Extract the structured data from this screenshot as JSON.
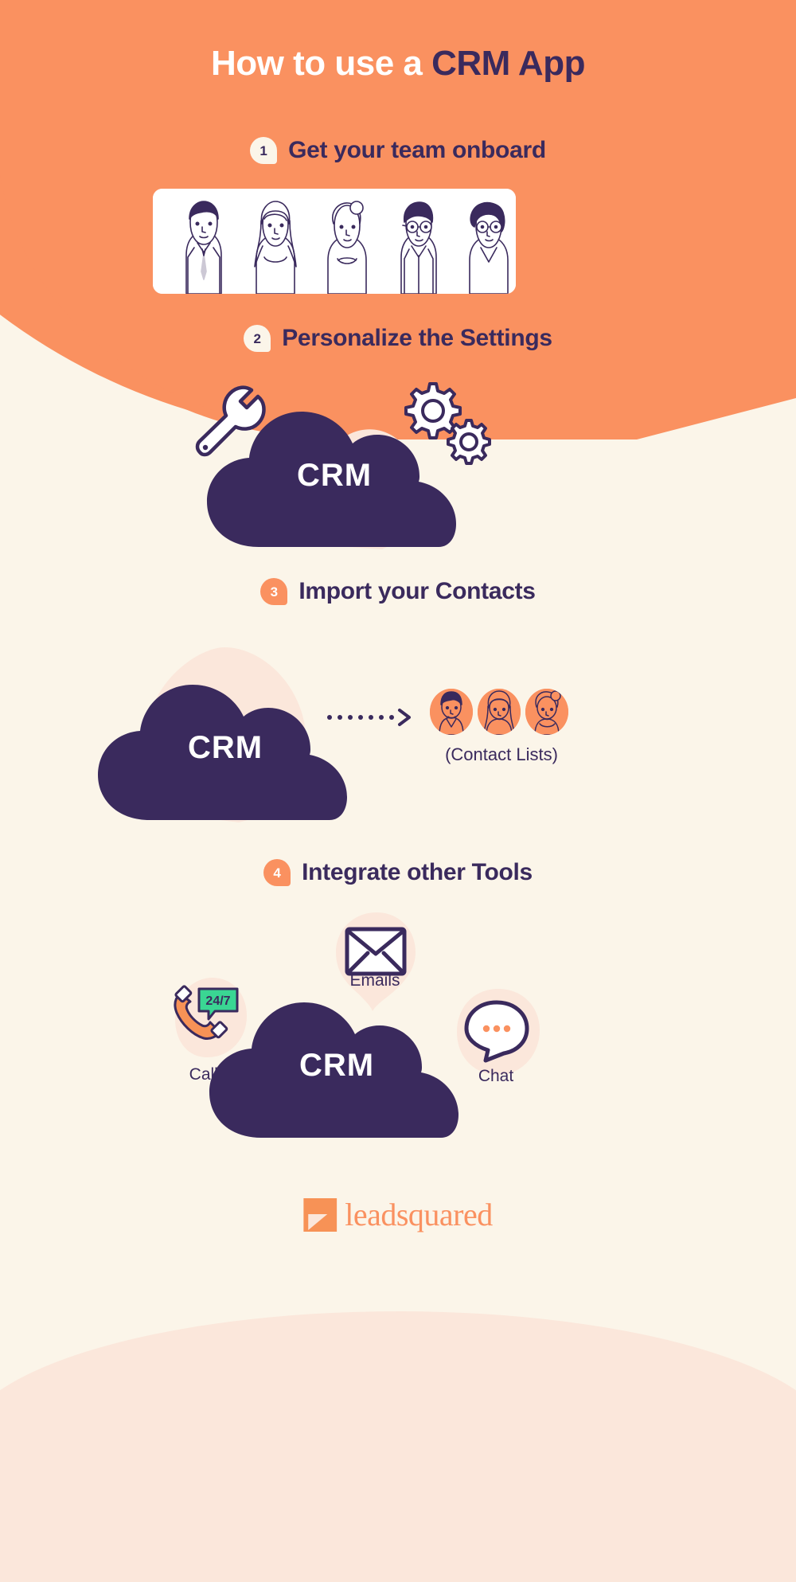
{
  "title": {
    "lead": "How to use a ",
    "accent": "CRM App"
  },
  "colors": {
    "orange": "#fa9160",
    "navy": "#3a2a5d",
    "cream": "#fbf5e9",
    "peach": "#fbe7db",
    "white": "#ffffff",
    "green": "#3ad693"
  },
  "steps": [
    {
      "number": "1",
      "label": "Get your team onboard",
      "badge_style": "cream"
    },
    {
      "number": "2",
      "label": "Personalize the Settings",
      "badge_style": "cream"
    },
    {
      "number": "3",
      "label": "Import your Contacts",
      "badge_style": "orange"
    },
    {
      "number": "4",
      "label": "Integrate other Tools",
      "badge_style": "orange"
    }
  ],
  "clouds": {
    "settings_label": "CRM",
    "contacts_label": "CRM",
    "tools_label": "CRM"
  },
  "contacts": {
    "caption": "(Contact Lists)",
    "avatar_count": 3
  },
  "tools": [
    {
      "name": "Calls",
      "icon": "phone-24-7-icon",
      "badge_text": "24/7"
    },
    {
      "name": "Emails",
      "icon": "envelope-icon",
      "badge_text": ""
    },
    {
      "name": "Chat",
      "icon": "chat-bubble-icon",
      "badge_text": ""
    }
  ],
  "footer": {
    "brand": "leadsquared"
  }
}
